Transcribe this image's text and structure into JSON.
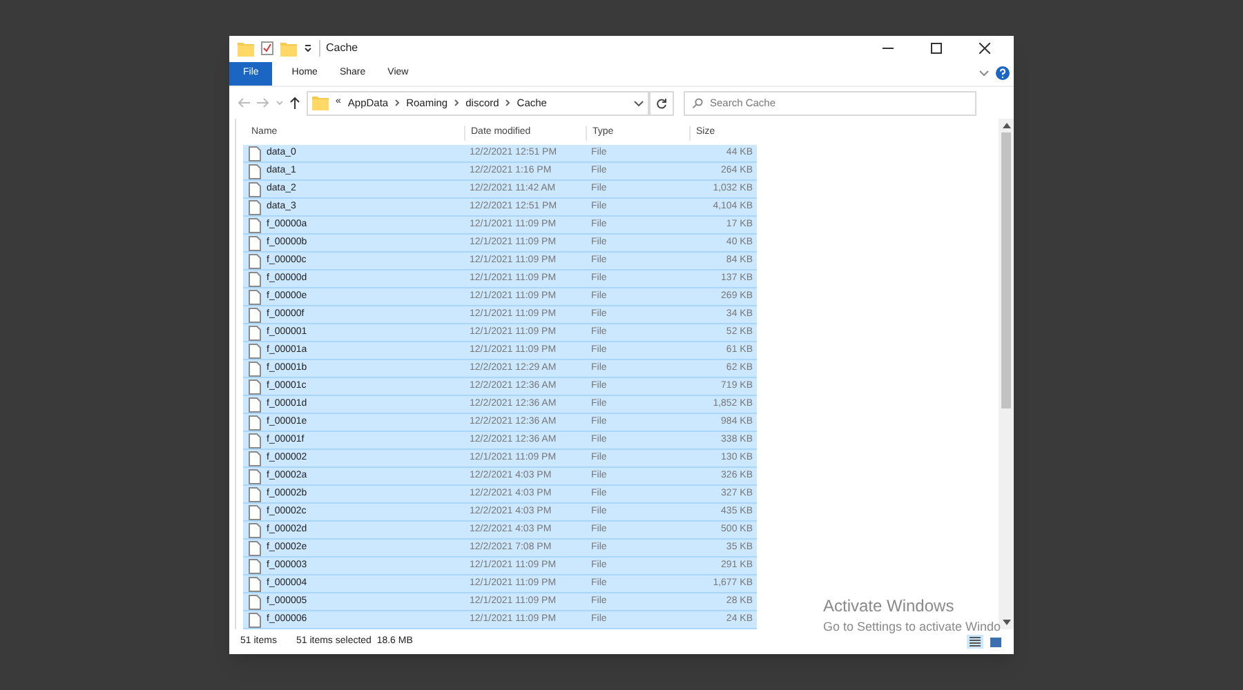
{
  "window": {
    "title": "Cache"
  },
  "ribbon_tabs": [
    {
      "label": "File",
      "selected": true
    },
    {
      "label": "Home",
      "selected": false
    },
    {
      "label": "Share",
      "selected": false
    },
    {
      "label": "View",
      "selected": false
    }
  ],
  "address_bar": {
    "overflow": "«",
    "path": [
      "AppData",
      "Roaming",
      "discord",
      "Cache"
    ]
  },
  "search": {
    "placeholder": "Search Cache"
  },
  "columns": [
    "Name",
    "Date modified",
    "Type",
    "Size"
  ],
  "rows": [
    {
      "name": "data_0",
      "date": "12/2/2021 12:51 PM",
      "type": "File",
      "size": "44 KB",
      "selected": true
    },
    {
      "name": "data_1",
      "date": "12/2/2021 1:16 PM",
      "type": "File",
      "size": "264 KB",
      "selected": true
    },
    {
      "name": "data_2",
      "date": "12/2/2021 11:42 AM",
      "type": "File",
      "size": "1,032 KB",
      "selected": true
    },
    {
      "name": "data_3",
      "date": "12/2/2021 12:51 PM",
      "type": "File",
      "size": "4,104 KB",
      "selected": true
    },
    {
      "name": "f_00000a",
      "date": "12/1/2021 11:09 PM",
      "type": "File",
      "size": "17 KB",
      "selected": true
    },
    {
      "name": "f_00000b",
      "date": "12/1/2021 11:09 PM",
      "type": "File",
      "size": "40 KB",
      "selected": true
    },
    {
      "name": "f_00000c",
      "date": "12/1/2021 11:09 PM",
      "type": "File",
      "size": "84 KB",
      "selected": true
    },
    {
      "name": "f_00000d",
      "date": "12/1/2021 11:09 PM",
      "type": "File",
      "size": "137 KB",
      "selected": true
    },
    {
      "name": "f_00000e",
      "date": "12/1/2021 11:09 PM",
      "type": "File",
      "size": "269 KB",
      "selected": true
    },
    {
      "name": "f_00000f",
      "date": "12/1/2021 11:09 PM",
      "type": "File",
      "size": "34 KB",
      "selected": true
    },
    {
      "name": "f_000001",
      "date": "12/1/2021 11:09 PM",
      "type": "File",
      "size": "52 KB",
      "selected": true
    },
    {
      "name": "f_00001a",
      "date": "12/1/2021 11:09 PM",
      "type": "File",
      "size": "61 KB",
      "selected": true
    },
    {
      "name": "f_00001b",
      "date": "12/2/2021 12:29 AM",
      "type": "File",
      "size": "62 KB",
      "selected": true
    },
    {
      "name": "f_00001c",
      "date": "12/2/2021 12:36 AM",
      "type": "File",
      "size": "719 KB",
      "selected": true
    },
    {
      "name": "f_00001d",
      "date": "12/2/2021 12:36 AM",
      "type": "File",
      "size": "1,852 KB",
      "selected": true
    },
    {
      "name": "f_00001e",
      "date": "12/2/2021 12:36 AM",
      "type": "File",
      "size": "984 KB",
      "selected": true
    },
    {
      "name": "f_00001f",
      "date": "12/2/2021 12:36 AM",
      "type": "File",
      "size": "338 KB",
      "selected": true
    },
    {
      "name": "f_000002",
      "date": "12/1/2021 11:09 PM",
      "type": "File",
      "size": "130 KB",
      "selected": true
    },
    {
      "name": "f_00002a",
      "date": "12/2/2021 4:03 PM",
      "type": "File",
      "size": "326 KB",
      "selected": true
    },
    {
      "name": "f_00002b",
      "date": "12/2/2021 4:03 PM",
      "type": "File",
      "size": "327 KB",
      "selected": true
    },
    {
      "name": "f_00002c",
      "date": "12/2/2021 4:03 PM",
      "type": "File",
      "size": "435 KB",
      "selected": true
    },
    {
      "name": "f_00002d",
      "date": "12/2/2021 4:03 PM",
      "type": "File",
      "size": "500 KB",
      "selected": true
    },
    {
      "name": "f_00002e",
      "date": "12/2/2021 7:08 PM",
      "type": "File",
      "size": "35 KB",
      "selected": true
    },
    {
      "name": "f_000003",
      "date": "12/1/2021 11:09 PM",
      "type": "File",
      "size": "291 KB",
      "selected": true
    },
    {
      "name": "f_000004",
      "date": "12/1/2021 11:09 PM",
      "type": "File",
      "size": "1,677 KB",
      "selected": true
    },
    {
      "name": "f_000005",
      "date": "12/1/2021 11:09 PM",
      "type": "File",
      "size": "28 KB",
      "selected": true
    },
    {
      "name": "f_000006",
      "date": "12/1/2021 11:09 PM",
      "type": "File",
      "size": "24 KB",
      "selected": true
    }
  ],
  "status_bar": {
    "count": "51 items",
    "selection": "51 items selected  18.6 MB"
  },
  "activation_notice": {
    "title": "Activate Windows",
    "text": "Go to Settings to activate Windo"
  }
}
